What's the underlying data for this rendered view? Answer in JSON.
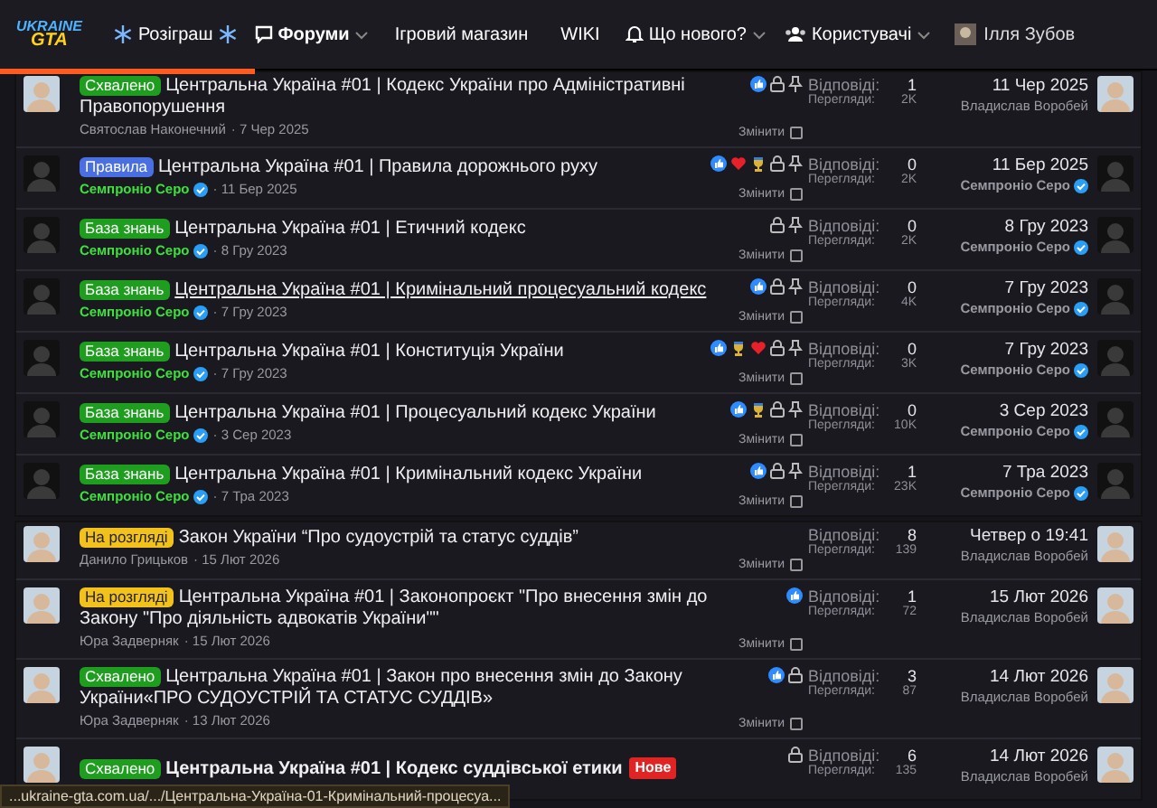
{
  "header": {
    "logo_top": "UKRAINE",
    "logo_bottom": "GTA",
    "nav": [
      {
        "label": "Розіграш",
        "kind": "snow",
        "selected": false,
        "dropdown": false
      },
      {
        "label": "Форуми",
        "kind": "chat",
        "selected": true,
        "dropdown": true
      },
      {
        "label": "Ігровий магазин",
        "kind": "plain",
        "selected": false,
        "dropdown": false
      },
      {
        "label": "WIKI",
        "kind": "plain",
        "selected": false,
        "dropdown": false
      },
      {
        "label": "Що нового?",
        "kind": "bell",
        "selected": false,
        "dropdown": true
      },
      {
        "label": "Користувачі",
        "kind": "users",
        "selected": false,
        "dropdown": true
      }
    ],
    "user": "Ілля Зубов"
  },
  "loading": {
    "level": 0.22
  },
  "sticky_threads": [
    {
      "prefix": {
        "label": "Схвалено",
        "kind": "approved"
      },
      "title": "Центральна Україна #01 | Кодекс України про Адміністративні Правопорушення",
      "hovered": false,
      "unread": false,
      "author": "Святослав Наконечний",
      "author_staff": false,
      "date": "· 7 Чер 2025",
      "reactions": [
        {
          "kind": "like"
        }
      ],
      "locked": true,
      "pinned": true,
      "edit": "Змінити",
      "checked": false,
      "replies_label": "Відповіді:",
      "replies": "1",
      "views_label": "Перегляди:",
      "views": "2K",
      "last_date": "11 Чер 2025",
      "last_user": "Владислав Воробей",
      "last_staff": false
    },
    {
      "prefix": {
        "label": "Правила",
        "kind": "rules"
      },
      "title": "Центральна Україна #01 | Правила дорожнього руху",
      "hovered": false,
      "unread": false,
      "author": "Семпроніо Серо",
      "author_staff": true,
      "date": "· 11 Бер 2025",
      "reactions": [
        {
          "kind": "like"
        },
        {
          "kind": "heart"
        },
        {
          "kind": "trophy"
        }
      ],
      "locked": true,
      "pinned": true,
      "edit": "Змінити",
      "checked": false,
      "replies_label": "Відповіді:",
      "replies": "0",
      "views_label": "Перегляди:",
      "views": "2K",
      "last_date": "11 Бер 2025",
      "last_user": "Семпроніо Серо",
      "last_staff": true
    },
    {
      "prefix": {
        "label": "База знань",
        "kind": "knowledge"
      },
      "title": "Центральна Україна #01 | Етичний кодекс",
      "hovered": false,
      "unread": false,
      "author": "Семпроніо Серо",
      "author_staff": true,
      "date": "· 8 Гру 2023",
      "locked": true,
      "pinned": true,
      "edit": "Змінити",
      "checked": false,
      "replies_label": "Відповіді:",
      "replies": "0",
      "views_label": "Перегляди:",
      "views": "2K",
      "last_date": "8 Гру 2023",
      "last_user": "Семпроніо Серо",
      "last_staff": true
    },
    {
      "prefix": {
        "label": "База знань",
        "kind": "knowledge"
      },
      "title": "Центральна Україна #01 | Кримінальний процесуальний кодекс",
      "hovered": true,
      "unread": false,
      "author": "Семпроніо Серо",
      "author_staff": true,
      "date": "· 7 Гру 2023",
      "reactions": [
        {
          "kind": "like"
        }
      ],
      "locked": true,
      "pinned": true,
      "edit": "Змінити",
      "checked": false,
      "replies_label": "Відповіді:",
      "replies": "0",
      "views_label": "Перегляди:",
      "views": "4K",
      "last_date": "7 Гру 2023",
      "last_user": "Семпроніо Серо",
      "last_staff": true
    },
    {
      "prefix": {
        "label": "База знань",
        "kind": "knowledge"
      },
      "title": "Центральна Україна #01 | Конституція України",
      "hovered": false,
      "unread": false,
      "author": "Семпроніо Серо",
      "author_staff": true,
      "date": "· 7 Гру 2023",
      "reactions": [
        {
          "kind": "like"
        },
        {
          "kind": "trophy"
        },
        {
          "kind": "heart"
        }
      ],
      "locked": true,
      "pinned": true,
      "edit": "Змінити",
      "checked": false,
      "replies_label": "Відповіді:",
      "replies": "0",
      "views_label": "Перегляди:",
      "views": "3K",
      "last_date": "7 Гру 2023",
      "last_user": "Семпроніо Серо",
      "last_staff": true
    },
    {
      "prefix": {
        "label": "База знань",
        "kind": "knowledge"
      },
      "title": "Центральна Україна #01 | Процесуальний кодекс України",
      "hovered": false,
      "unread": false,
      "author": "Семпроніо Серо",
      "author_staff": true,
      "date": "· 3 Сер 2023",
      "reactions": [
        {
          "kind": "like"
        },
        {
          "kind": "trophy"
        }
      ],
      "locked": true,
      "pinned": true,
      "edit": "Змінити",
      "checked": false,
      "replies_label": "Відповіді:",
      "replies": "0",
      "views_label": "Перегляди:",
      "views": "10K",
      "last_date": "3 Сер 2023",
      "last_user": "Семпроніо Серо",
      "last_staff": true
    },
    {
      "prefix": {
        "label": "База знань",
        "kind": "knowledge"
      },
      "title": "Центральна Україна #01 | Кримінальний кодекс України",
      "hovered": false,
      "unread": false,
      "author": "Семпроніо Серо",
      "author_staff": true,
      "date": "· 7 Тра 2023",
      "reactions": [
        {
          "kind": "like"
        }
      ],
      "locked": true,
      "pinned": true,
      "edit": "Змінити",
      "checked": false,
      "replies_label": "Відповіді:",
      "replies": "1",
      "views_label": "Перегляди:",
      "views": "23K",
      "last_date": "7 Тра 2023",
      "last_user": "Семпроніо Серо",
      "last_staff": true
    }
  ],
  "threads": [
    {
      "prefix": {
        "label": "На розгляді",
        "kind": "review"
      },
      "title": "Закон України “Про судоустрій та статус суддів”",
      "hovered": false,
      "unread": false,
      "author": "Данило Грицьков",
      "author_staff": false,
      "date": "· 15 Лют 2026",
      "locked": false,
      "pinned": false,
      "edit": "Змінити",
      "checked": false,
      "replies_label": "Відповіді:",
      "replies": "8",
      "views_label": "Перегляди:",
      "views": "139",
      "last_date": "Четвер о 19:41",
      "last_user": "Владислав Воробей",
      "last_staff": false
    },
    {
      "prefix": {
        "label": "На розгляді",
        "kind": "review"
      },
      "title": "Центральна Україна #01 | Законопроєкт \"Про внесення змін до Закону \"Про діяльність адвокатів України\"\"",
      "hovered": false,
      "unread": false,
      "author": "Юра Задверняк",
      "author_staff": false,
      "date": "· 15 Лют 2026",
      "reactions": [
        {
          "kind": "like"
        }
      ],
      "locked": false,
      "pinned": false,
      "edit": "Змінити",
      "checked": false,
      "replies_label": "Відповіді:",
      "replies": "1",
      "views_label": "Перегляди:",
      "views": "72",
      "last_date": "15 Лют 2026",
      "last_user": "Владислав Воробей",
      "last_staff": false
    },
    {
      "prefix": {
        "label": "Схвалено",
        "kind": "approved"
      },
      "title": "Центральна Україна #01 | Закон про внесення змін до Закону України«ПРО СУДОУСТРІЙ ТА СТАТУС СУДДІВ»",
      "hovered": false,
      "unread": false,
      "author": "Юра Задверняк",
      "author_staff": false,
      "date": "· 13 Лют 2026",
      "reactions": [
        {
          "kind": "like"
        }
      ],
      "locked": true,
      "pinned": false,
      "edit": "Змінити",
      "checked": false,
      "replies_label": "Відповіді:",
      "replies": "3",
      "views_label": "Перегляди:",
      "views": "87",
      "last_date": "14 Лют 2026",
      "last_user": "Владислав Воробей",
      "last_staff": false
    },
    {
      "prefix": {
        "label": "Схвалено",
        "kind": "approved"
      },
      "title": "Центральна Україна #01 | Кодекс суддівської етики",
      "new_badge": "Нове",
      "hovered": false,
      "unread": true,
      "locked": true,
      "pinned": false,
      "replies_label": "Відповіді:",
      "replies": "6",
      "views_label": "Перегляди:",
      "views": "135",
      "last_date": "14 Лют 2026",
      "last_user": "Владислав Воробей",
      "last_staff": false
    }
  ],
  "status_url": "...ukraine-gta.com.ua/.../Центральна-Україна-01-Кримінальний-процесуа..."
}
